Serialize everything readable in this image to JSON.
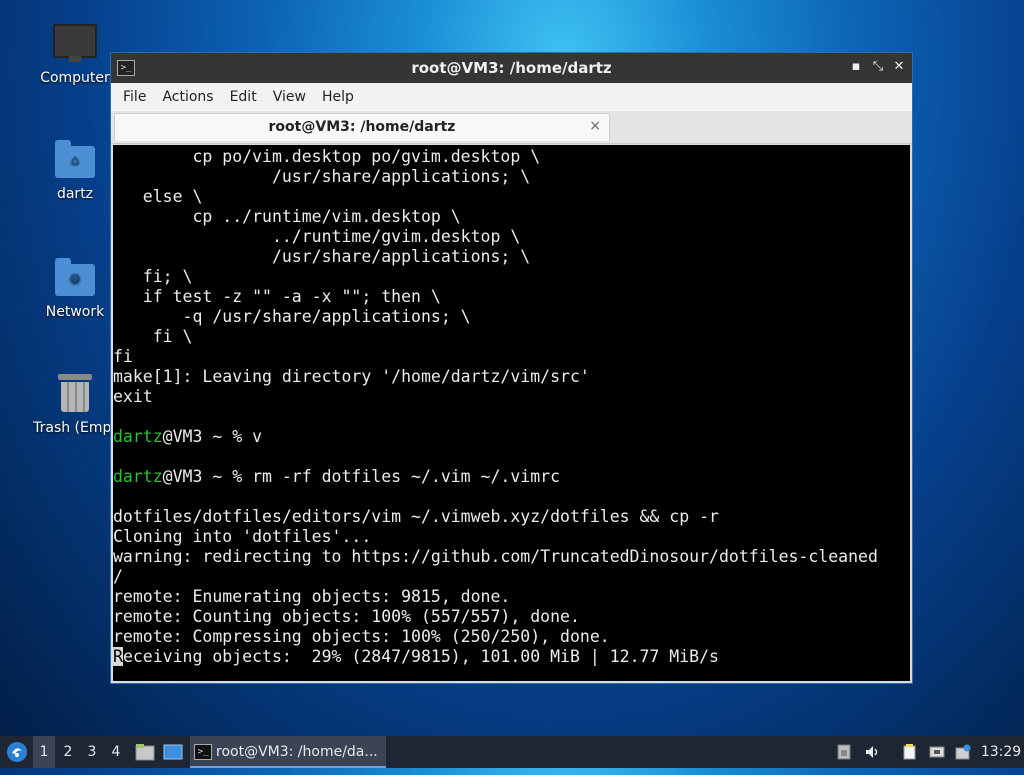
{
  "desktop": {
    "icons": [
      {
        "label": "Computer",
        "icon": "computer-icon"
      },
      {
        "label": "dartz",
        "icon": "home-folder-icon"
      },
      {
        "label": "Network",
        "icon": "network-folder-icon"
      },
      {
        "label": "Trash (Empt",
        "icon": "trash-icon"
      }
    ]
  },
  "window": {
    "title": "root@VM3: /home/dartz",
    "menu": [
      "File",
      "Actions",
      "Edit",
      "View",
      "Help"
    ],
    "tab_label": "root@VM3: /home/dartz",
    "tab_close": "×",
    "controls": {
      "minimize": "▪",
      "maximize": "⤡",
      "close": "✕"
    }
  },
  "terminal": {
    "lines": [
      "        cp po/vim.desktop po/gvim.desktop \\",
      "                /usr/share/applications; \\",
      "   else \\",
      "        cp ../runtime/vim.desktop \\",
      "                ../runtime/gvim.desktop \\",
      "                /usr/share/applications; \\",
      "   fi; \\",
      "   if test -z \"\" -a -x \"\"; then \\",
      "       -q /usr/share/applications; \\",
      "    fi \\",
      "fi",
      "make[1]: Leaving directory '/home/dartz/vim/src'",
      "exit",
      "",
      "",
      "",
      "",
      "dotfiles/dotfiles/editors/vim ~/.vimweb.xyz/dotfiles && cp -r",
      "Cloning into 'dotfiles'...",
      "warning: redirecting to https://github.com/TruncatedDinosour/dotfiles-cleaned",
      "/",
      "remote: Enumerating objects: 9815, done.",
      "remote: Counting objects: 100% (557/557), done.",
      "remote: Compressing objects: 100% (250/250), done."
    ],
    "prompt1_user": "dartz",
    "prompt1_rest": "@VM3 ~ % v",
    "prompt2_user": "dartz",
    "prompt2_rest": "@VM3 ~ % rm -rf dotfiles ~/.vim ~/.vimrc",
    "last_line_cursor": "R",
    "last_line_rest": "eceiving objects:  29% (2847/9815), 101.00 MiB | 12.77 MiB/s"
  },
  "taskbar": {
    "workspaces": [
      "1",
      "2",
      "3",
      "4"
    ],
    "active_task": "root@VM3: /home/da...",
    "clock": "13:29"
  },
  "colors": {
    "prompt_green": "#2ec12e",
    "terminal_bg": "#000000",
    "window_border": "#2a6db5"
  }
}
